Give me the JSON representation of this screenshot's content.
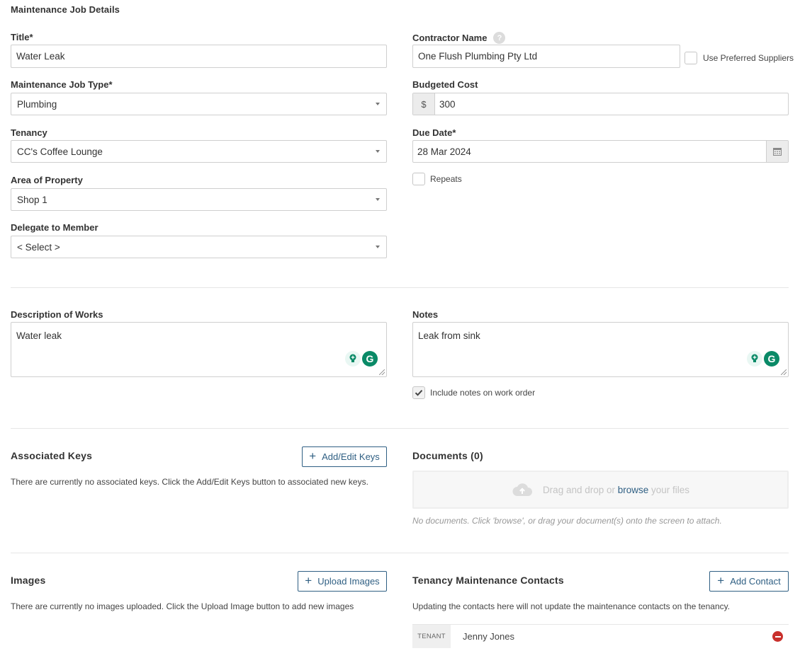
{
  "page": {
    "title": "Maintenance Job Details"
  },
  "form": {
    "title": {
      "label": "Title*",
      "value": "Water Leak"
    },
    "job_type": {
      "label": "Maintenance Job Type*",
      "value": "Plumbing"
    },
    "tenancy": {
      "label": "Tenancy",
      "value": "CC's Coffee Lounge"
    },
    "area": {
      "label": "Area of Property",
      "value": "Shop 1"
    },
    "delegate": {
      "label": "Delegate to Member",
      "value": "< Select >"
    },
    "contractor": {
      "label": "Contractor Name",
      "help": "?",
      "value": "One Flush Plumbing Pty Ltd",
      "preferred_label": "Use Preferred Suppliers"
    },
    "budget": {
      "label": "Budgeted Cost",
      "currency": "$",
      "value": "300"
    },
    "due_date": {
      "label": "Due Date*",
      "value": "28 Mar 2024"
    },
    "repeats": {
      "label": "Repeats",
      "checked": false
    }
  },
  "description": {
    "label": "Description of Works",
    "value": "Water leak"
  },
  "notes": {
    "label": "Notes",
    "value": "Leak from sink",
    "include_label": "Include notes on work order",
    "include_checked": true
  },
  "keys": {
    "title": "Associated Keys",
    "button": "Add/Edit Keys",
    "empty": "There are currently no associated keys. Click the Add/Edit Keys button to associated new keys."
  },
  "documents": {
    "title": "Documents (0)",
    "drop_prefix": "Drag and drop or ",
    "drop_link": "browse",
    "drop_suffix": " your files",
    "empty": "No documents. Click 'browse', or drag your document(s) onto the screen to attach."
  },
  "images": {
    "title": "Images",
    "button": "Upload Images",
    "empty": "There are currently no images uploaded. Click the Upload Image button to add new images"
  },
  "contacts": {
    "title": "Tenancy Maintenance Contacts",
    "button": "Add Contact",
    "info": "Updating the contacts here will not update the maintenance contacts on the tenancy.",
    "rows": [
      {
        "type": "TENANT",
        "name": "Jenny Jones"
      }
    ]
  },
  "colors": {
    "accent": "#2f5f83",
    "remove": "#c9302c",
    "grammarly": "#0a8a67"
  }
}
